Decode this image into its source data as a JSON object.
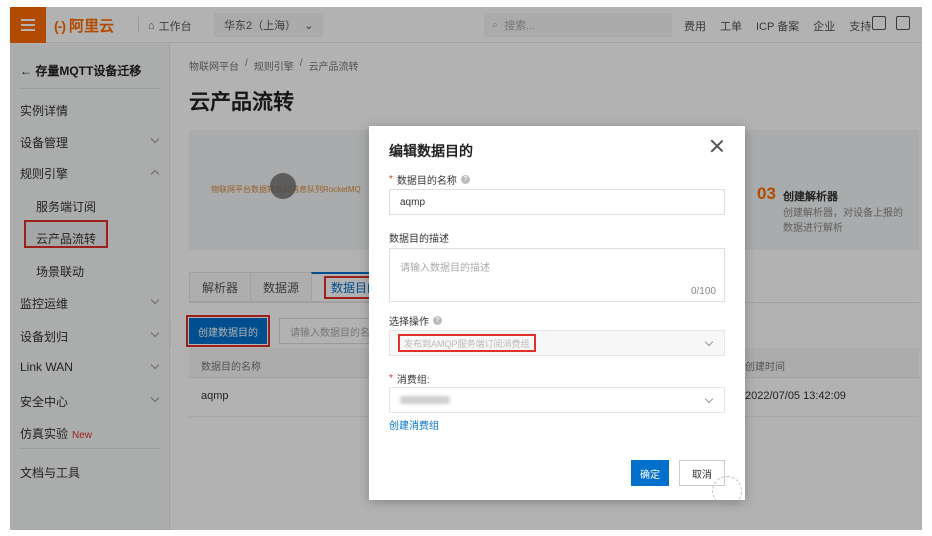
{
  "header": {
    "logo_text": "阿里云",
    "logo_mark": "(-)",
    "workbench": "工作台",
    "region": "华东2（上海）",
    "search_placeholder": "搜索...",
    "links": [
      "费用",
      "工单",
      "ICP 备案",
      "企业",
      "支持"
    ]
  },
  "sidebar": {
    "back_label": "存量MQTT设备迁移",
    "items": [
      {
        "label": "实例详情"
      },
      {
        "label": "设备管理"
      },
      {
        "label": "规则引擎"
      },
      {
        "label": "服务端订阅"
      },
      {
        "label": "云产品流转"
      },
      {
        "label": "场景联动"
      },
      {
        "label": "监控运维"
      },
      {
        "label": "设备划归"
      },
      {
        "label": "Link WAN"
      },
      {
        "label": "安全中心"
      },
      {
        "label": "仿真实验"
      },
      {
        "label": "文档与工具"
      }
    ],
    "new_tag": "New"
  },
  "main": {
    "breadcrumb": [
      "物联网平台",
      "/",
      "规则引擎",
      "/",
      "云产品流转"
    ],
    "title": "云产品流转",
    "banner": {
      "flow_label": "物联网平台数据转发到消息队列RocketMQ",
      "step_num": "03",
      "step_title": "创建解析器",
      "step_desc": "创建解析器，对设备上报的数据进行解析"
    },
    "tabs": [
      "解析器",
      "数据源",
      "数据目的"
    ],
    "create_button": "创建数据目的",
    "filter_placeholder": "请输入数据目的名称",
    "table": {
      "col_name": "数据目的名称",
      "col_time": "创建时间",
      "row": {
        "name": "aqmp",
        "time": "2022/07/05 13:42:09"
      }
    }
  },
  "dialog": {
    "title": "编辑数据目的",
    "name_label": "数据目的名称",
    "name_value": "aqmp",
    "desc_label": "数据目的描述",
    "desc_placeholder": "请输入数据目的描述",
    "desc_count": "0/100",
    "op_label": "选择操作",
    "op_value": "发布到AMQP服务端订阅消费组",
    "group_label": "消费组:",
    "create_group_link": "创建消费组",
    "ok_label": "确定",
    "cancel_label": "取消"
  },
  "colors": {
    "brand": "#ff6a00",
    "primary": "#0070cc",
    "highlight": "#e0302a"
  }
}
